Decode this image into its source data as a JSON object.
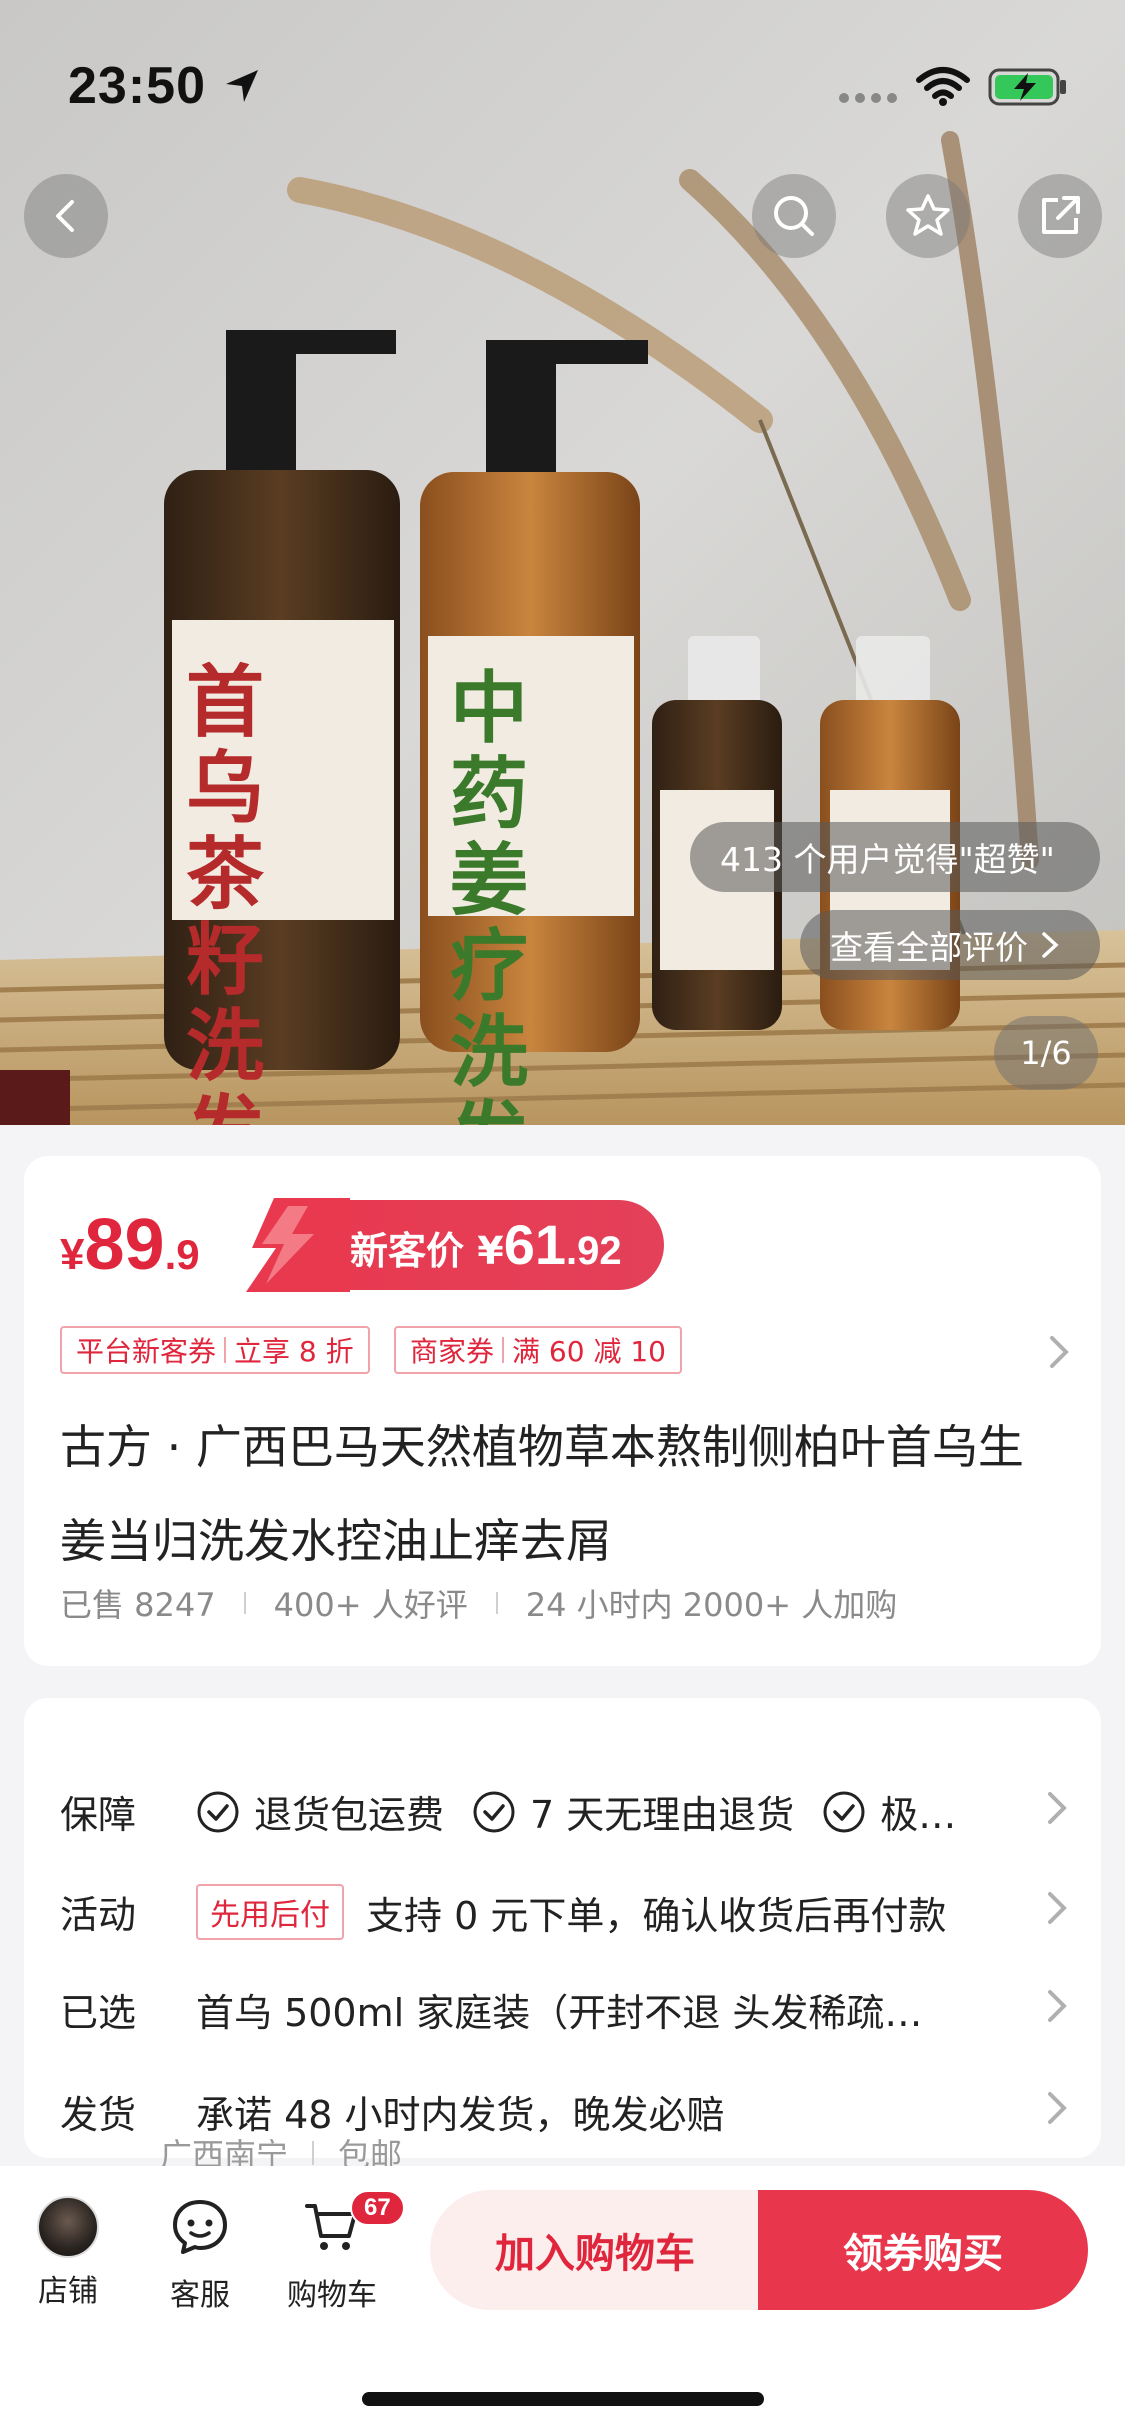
{
  "status_bar": {
    "time": "23:50"
  },
  "gallery": {
    "product_label_1": "首乌茶籽洗发液",
    "product_label_2": "中药姜疗洗发液",
    "users_like": "413 个用户觉得\"超赞\"",
    "view_reviews": "查看全部评价",
    "counter": "1/6"
  },
  "price": {
    "currency": "¥",
    "integer": "89",
    "decimal": ".9",
    "new_label": "新客价",
    "new_currency": "¥",
    "new_integer": "61",
    "new_decimal": ".92"
  },
  "coupons": [
    {
      "left": "平台新客券",
      "right": "立享 8 折"
    },
    {
      "left": "商家券",
      "right": "满 60 减 10"
    }
  ],
  "product": {
    "title": "古方 · 广西巴马天然植物草本熬制侧柏叶首乌生姜当归洗发水控油止痒去屑",
    "sold": "已售 8247",
    "good_reviews": "400+ 人好评",
    "added": "24 小时内 2000+ 人加购"
  },
  "info": {
    "guarantee_label": "保障",
    "guarantees": [
      "退货包运费",
      "7 天无理由退货",
      "极…"
    ],
    "activity_label": "活动",
    "activity_tag": "先用后付",
    "activity_text": "支持 0 元下单，确认收货后再付款",
    "selected_label": "已选",
    "selected_text": "首乌 500ml 家庭装（开封不退 头发稀疏…",
    "ship_label": "发货",
    "ship_text": "承诺 48 小时内发货，晚发必赔",
    "ship_origin": "广西南宁",
    "ship_free": "包邮"
  },
  "bottom_bar": {
    "shop": "店铺",
    "service": "客服",
    "cart": "购物车",
    "cart_count": "67",
    "add_to_cart": "加入购物车",
    "buy": "领券购买"
  },
  "colors": {
    "accent": "#e0263c",
    "accent_light": "#fdeeee"
  }
}
